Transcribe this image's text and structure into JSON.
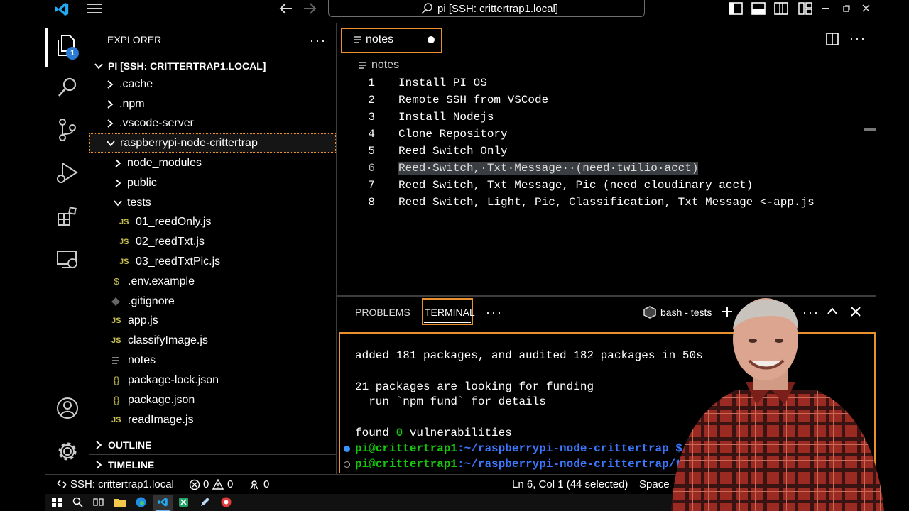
{
  "titlebar": {
    "search_text": "pi [SSH: crittertrap1.local]"
  },
  "activity": {
    "explorer_badge": "1"
  },
  "explorer": {
    "title": "EXPLORER",
    "root": "PI [SSH: CRITTERTRAP1.LOCAL]",
    "items": [
      {
        "label": ".cache"
      },
      {
        "label": ".npm"
      },
      {
        "label": ".vscode-server"
      },
      {
        "label": "raspberrypi-node-crittertrap"
      },
      {
        "label": "node_modules"
      },
      {
        "label": "public"
      },
      {
        "label": "tests"
      },
      {
        "label": "01_reedOnly.js"
      },
      {
        "label": "02_reedTxt.js"
      },
      {
        "label": "03_reedTxtPic.js"
      },
      {
        "label": ".env.example"
      },
      {
        "label": ".gitignore"
      },
      {
        "label": "app.js"
      },
      {
        "label": "classifyImage.js"
      },
      {
        "label": "notes"
      },
      {
        "label": "package-lock.json"
      },
      {
        "label": "package.json"
      },
      {
        "label": "readImage.js"
      }
    ],
    "outline": "OUTLINE",
    "timeline": "TIMELINE",
    "js_badge": "JS",
    "json_badge": "{}",
    "dollar_badge": "$"
  },
  "editor": {
    "tab_label": "notes",
    "breadcrumb": "notes",
    "lines": [
      {
        "num": "1",
        "text": "Install PI OS"
      },
      {
        "num": "2",
        "text": "Remote SSH from VSCode"
      },
      {
        "num": "3",
        "text": "Install Nodejs"
      },
      {
        "num": "4",
        "text": "Clone Repository"
      },
      {
        "num": "5",
        "text": "Reed Switch Only"
      },
      {
        "num": "6",
        "text": "Reed·Switch,·Txt·Message··(need·twilio·acct)"
      },
      {
        "num": "7",
        "text": "Reed Switch, Txt Message, Pic (need cloudinary acct)"
      },
      {
        "num": "8",
        "text": "Reed Switch, Light, Pic, Classification, Txt Message <-app.js"
      }
    ]
  },
  "panel": {
    "tab_problems": "PROBLEMS",
    "tab_terminal": "TERMINAL",
    "terminal_name": "bash - tests",
    "lines": [
      "added 181 packages, and audited 182 packages in 50s",
      "21 packages are looking for funding",
      "  run `npm fund` for details",
      "found ",
      " vulnerabilities"
    ],
    "found_count": "0",
    "prompt_user": "pi@crittertrap1",
    "prompt_path1": ":~/raspberrypi-node-crittertrap $",
    "prompt_path2": ":~/raspberrypi-node-crittertrap/te"
  },
  "status": {
    "remote": "SSH: crittertrap1.local",
    "errors": "0",
    "warnings": "0",
    "ports": "0",
    "position": "Ln 6, Col 1 (44 selected)",
    "spaces": "Space"
  },
  "colors": {
    "accent": "#e8912d",
    "vscode_blue": "#23a9f2",
    "terminal_green": "#16c60c",
    "selection": "#3a3d41",
    "js_yellow": "#c8c050"
  }
}
